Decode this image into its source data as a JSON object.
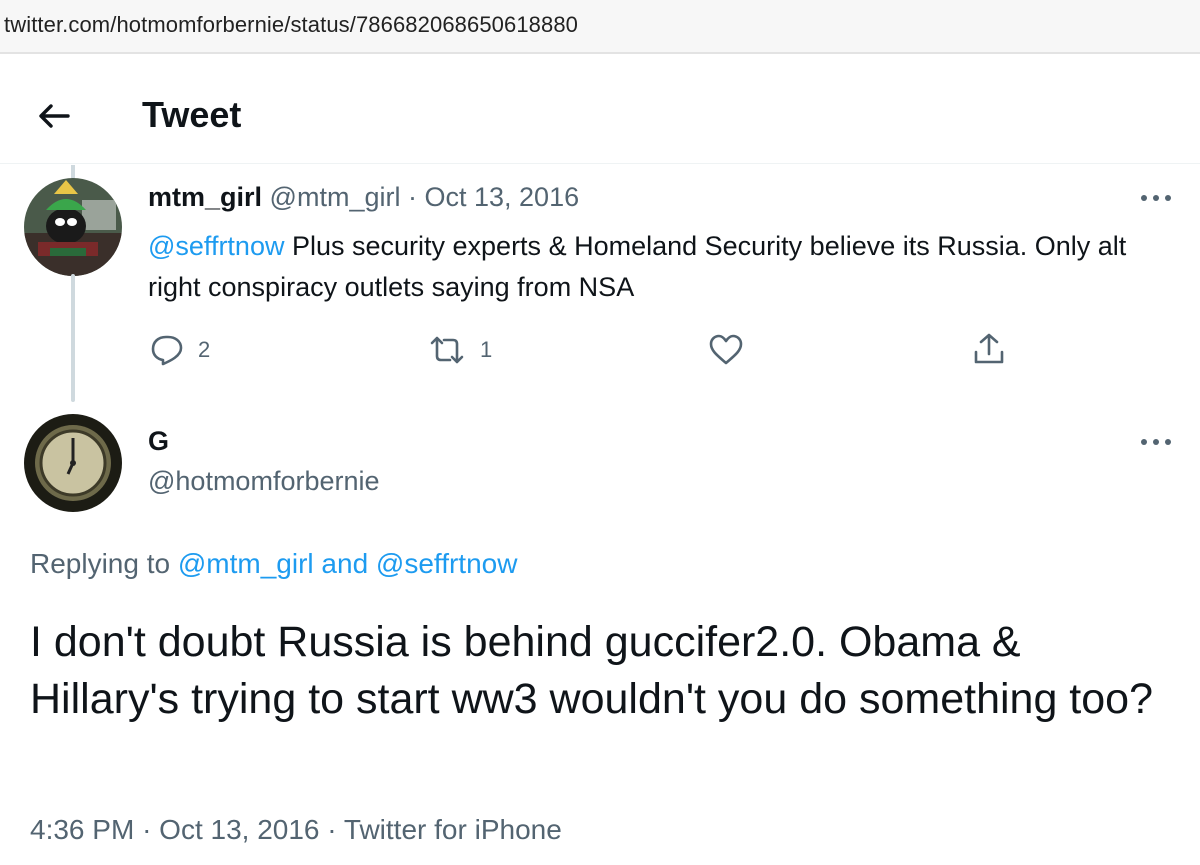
{
  "browser": {
    "url": "twitter.com/hotmomforbernie/status/786682068650618880"
  },
  "header": {
    "title": "Tweet"
  },
  "parent_tweet": {
    "name": "mtm_girl",
    "handle": "@mtm_girl",
    "separator": "·",
    "date": "Oct 13, 2016",
    "mention": "@seffrtnow",
    "text": " Plus security experts & Homeland Security believe its Russia. Only alt right conspiracy outlets saying from NSA",
    "replies": "2",
    "retweets": "1"
  },
  "main_tweet": {
    "name": "G",
    "handle": "@hotmomforbernie",
    "replying_prefix": "Replying to ",
    "replying_user1": "@mtm_girl",
    "replying_and": " and ",
    "replying_user2": "@seffrtnow",
    "text": "I don't doubt Russia is behind guccifer2.0. Obama & Hillary's trying to start ww3 wouldn't you do something too?",
    "time": "4:36 PM",
    "separator": "·",
    "date": "Oct 13, 2016",
    "source": "Twitter for iPhone"
  },
  "colors": {
    "accent": "#1d9bf0",
    "muted": "#536471",
    "text": "#0f1419",
    "thread_line": "#cfd9de"
  },
  "icons": [
    "back-arrow-icon",
    "more-icon",
    "reply-icon",
    "retweet-icon",
    "like-icon",
    "share-icon"
  ]
}
